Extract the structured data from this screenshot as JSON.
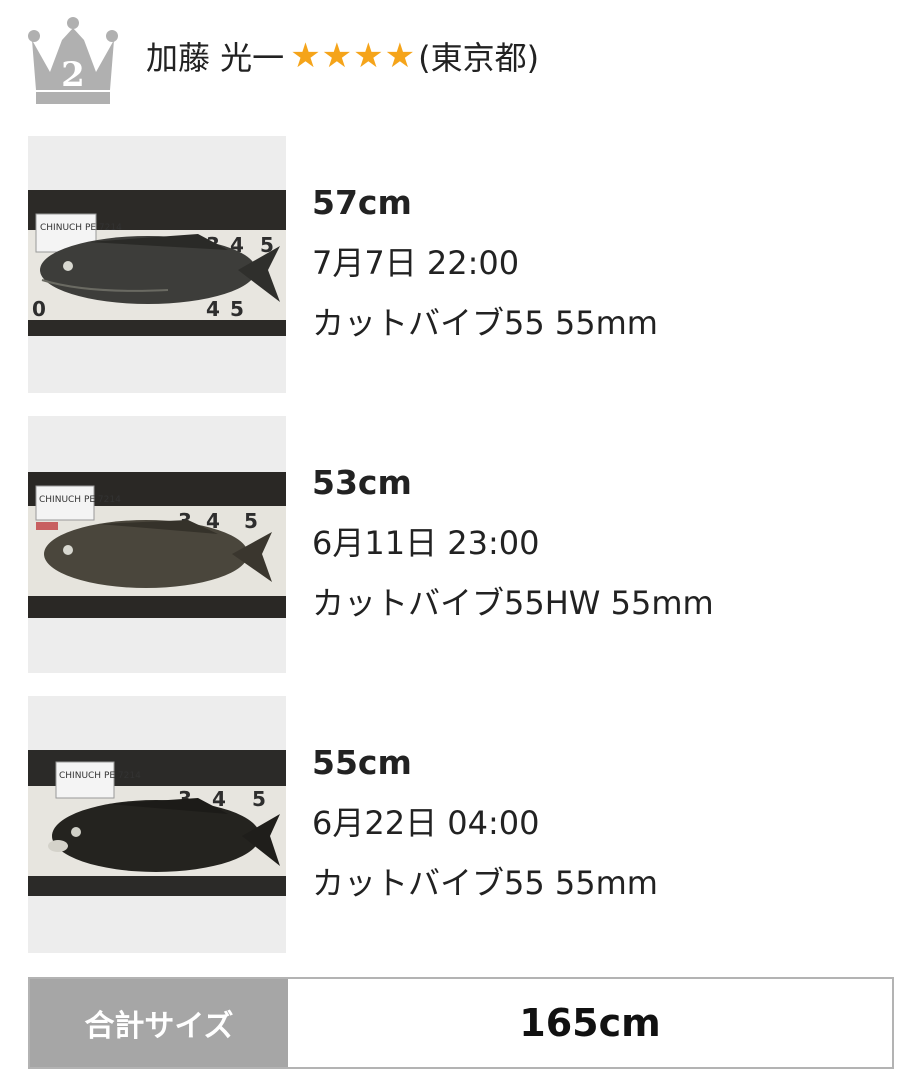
{
  "angler": {
    "rank_icon": "crown-icon",
    "rank_number": "2",
    "name": "加藤 光一",
    "stars": "★★★★",
    "region": "(東京都)"
  },
  "catches": [
    {
      "size": "57cm",
      "datetime": "7月7日 22:00",
      "lure": "カットバイブ55 55mm",
      "photo_tag": "CHINUCH PE 7214"
    },
    {
      "size": "53cm",
      "datetime": "6月11日 23:00",
      "lure": "カットバイブ55HW 55mm",
      "photo_tag": "CHINUCH PE 7214"
    },
    {
      "size": "55cm",
      "datetime": "6月22日 04:00",
      "lure": "カットバイブ55 55mm",
      "photo_tag": "CHINUCH PE 7214"
    }
  ],
  "total": {
    "label": "合計サイズ",
    "value": "165cm"
  },
  "colors": {
    "star": "#f5a41a",
    "crown": "#b0b0b0",
    "label_bg": "#a6a6a6"
  }
}
